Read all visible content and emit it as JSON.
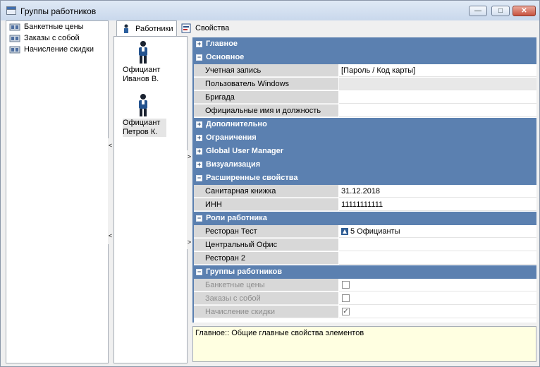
{
  "window": {
    "title": "Группы работников",
    "buttons": {
      "minimize": "—",
      "maximize": "□",
      "close": "✕"
    }
  },
  "tree": {
    "items": [
      {
        "label": "Банкетные цены",
        "icon": "group-icon"
      },
      {
        "label": "Заказы с собой",
        "icon": "group-icon"
      },
      {
        "label": "Начисление скидки",
        "icon": "group-icon"
      }
    ]
  },
  "tabs": [
    {
      "label": "Работники",
      "icon": "worker-icon",
      "active": true
    },
    {
      "label": "Свойства",
      "icon": "properties-icon",
      "active": false
    }
  ],
  "workers": [
    {
      "name": "Официант Иванов В.",
      "icon": "waiter-icon"
    },
    {
      "name": "Официант Петров К.",
      "icon": "waiter-icon"
    }
  ],
  "splitters": {
    "left_arrow": "<",
    "right_arrow": ">"
  },
  "grid": {
    "cat_main": "Главное",
    "cat_basic": "Основное",
    "account_label": "Учетная запись",
    "account_value": "[Пароль / Код карты]",
    "winuser_label": "Пользователь Windows",
    "team_label": "Бригада",
    "official_label": "Официальные имя и должность",
    "cat_additional": "Дополнительно",
    "cat_restrictions": "Ограничения",
    "cat_gum": "Global User Manager",
    "cat_visual": "Визуализация",
    "cat_extended": "Расширенные свойства",
    "sanbook_label": "Санитарная книжка",
    "sanbook_value": "31.12.2018",
    "inn_label": "ИНН",
    "inn_value": "11111111111",
    "cat_roles": "Роли работника",
    "rest_test_label": "Ресторан Тест",
    "rest_test_value": "5 Официанты",
    "central_label": "Центральный Офис",
    "rest2_label": "Ресторан 2",
    "cat_groups": "Группы работников",
    "banquet_label": "Банкетные цены",
    "banquet_checked": false,
    "takeaway_label": "Заказы с собой",
    "takeaway_checked": false,
    "discount_label": "Начисление скидки",
    "discount_checked": true,
    "expander_plus": "+",
    "expander_minus": "−",
    "check_mark": "✓"
  },
  "description": "Главное:: Общие главные свойства элементов",
  "colors": {
    "category_header": "#5b80b0",
    "description_bg": "#ffffe1"
  }
}
